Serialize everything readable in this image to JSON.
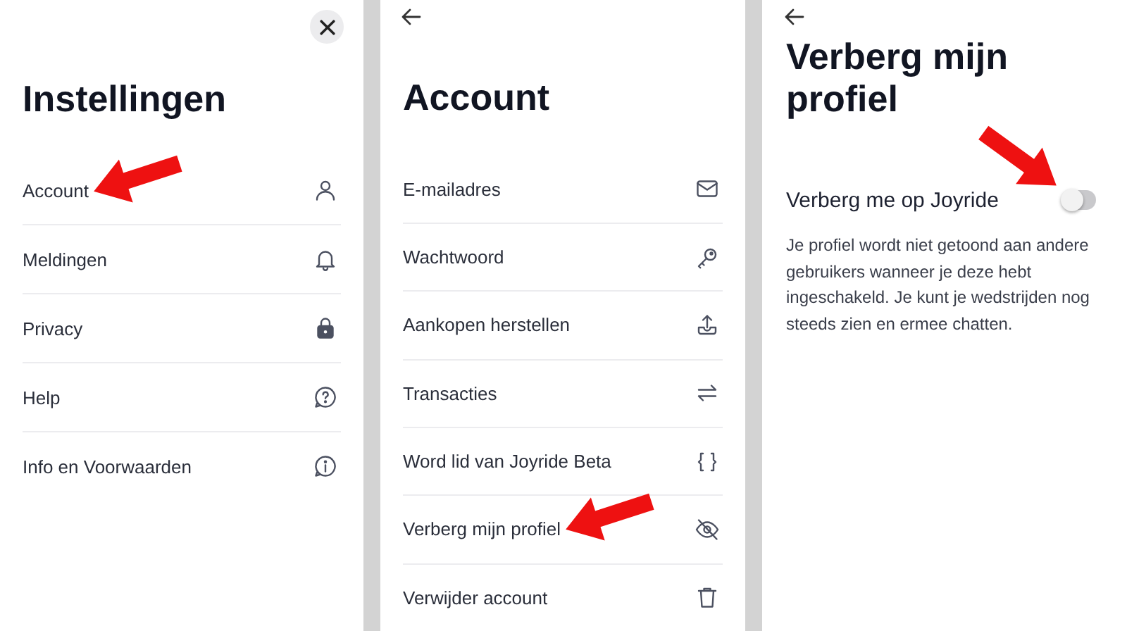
{
  "settings": {
    "title": "Instellingen",
    "items": [
      {
        "label": "Account",
        "pointer": true
      },
      {
        "label": "Meldingen",
        "pointer": false
      },
      {
        "label": "Privacy",
        "pointer": false
      },
      {
        "label": "Help",
        "pointer": false
      },
      {
        "label": "Info en Voorwaarden",
        "pointer": false
      }
    ]
  },
  "account": {
    "title": "Account",
    "items": [
      {
        "label": "E-mailadres",
        "pointer": false
      },
      {
        "label": "Wachtwoord",
        "pointer": false
      },
      {
        "label": "Aankopen herstellen",
        "pointer": false
      },
      {
        "label": "Transacties",
        "pointer": false
      },
      {
        "label": "Word lid van Joyride Beta",
        "pointer": false
      },
      {
        "label": "Verberg mijn profiel",
        "pointer": true
      },
      {
        "label": "Verwijder account",
        "pointer": false
      }
    ]
  },
  "hide_profile": {
    "title": "Verberg mijn profiel",
    "toggle": {
      "label": "Verberg me op Joyride",
      "on": false,
      "pointer": true
    },
    "description": "Je profiel wordt niet getoond aan andere gebruikers wanneer je deze hebt ingeschakeld. Je kunt je wedstrijden nog steeds zien en ermee chatten."
  }
}
